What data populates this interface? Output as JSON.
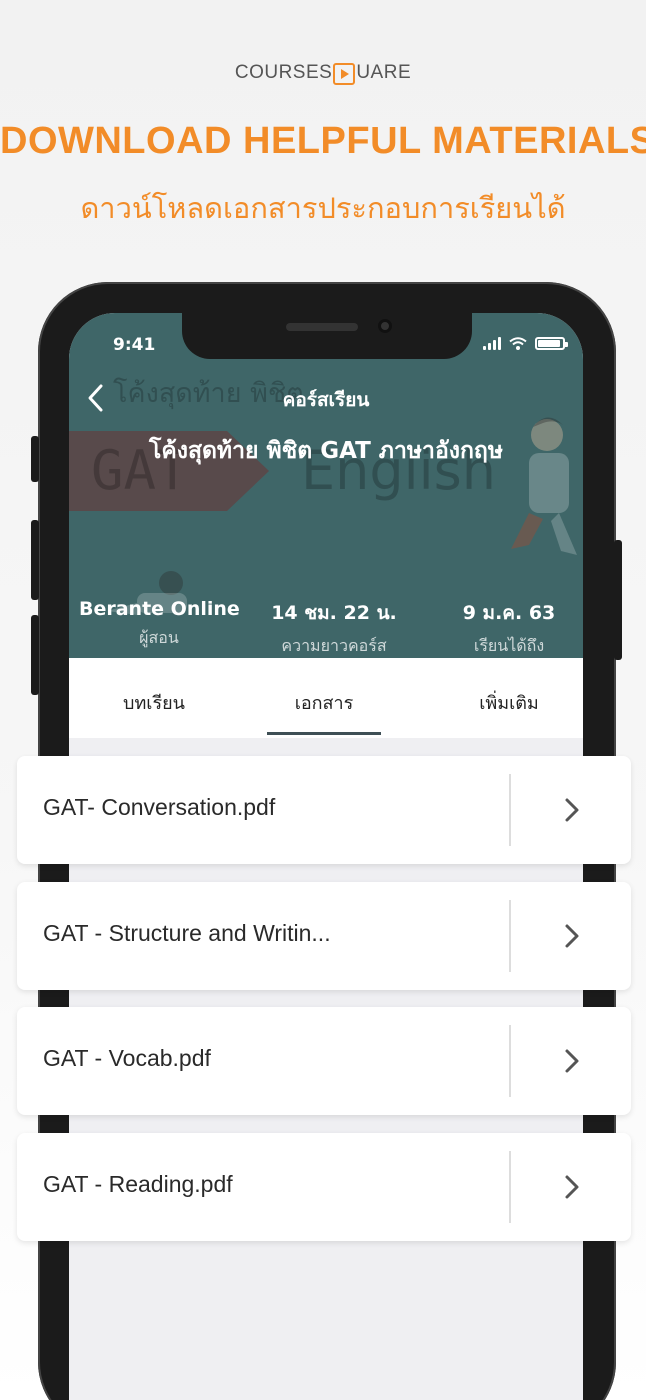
{
  "promo": {
    "logo_left": "COURSES",
    "logo_right": "UARE",
    "headline": "DOWNLOAD HELPFUL MATERIALS",
    "subheadline": "ดาวน์โหลดเอกสารประกอบการเรียนได้"
  },
  "status_bar": {
    "time": "9:41"
  },
  "nav": {
    "title": "คอร์สเรียน"
  },
  "course": {
    "title": "โค้งสุดท้าย พิชิต GAT ภาษาอังกฤษ",
    "hero_bg_title": "โค้งสุดท้าย พิชิต",
    "hero_bg_gat": "GAT",
    "hero_bg_english": "English",
    "stats": [
      {
        "value": "Berante Online",
        "label": "ผู้สอน"
      },
      {
        "value": "14 ชม. 22 น.",
        "label": "ความยาวคอร์ส"
      },
      {
        "value": "9 ม.ค. 63",
        "label": "เรียนได้ถึง"
      }
    ]
  },
  "tabs": [
    {
      "label": "บทเรียน",
      "active": false
    },
    {
      "label": "เอกสาร",
      "active": true
    },
    {
      "label": "เพิ่มเติม",
      "active": false
    }
  ],
  "files": [
    {
      "name": "GAT- Conversation.pdf"
    },
    {
      "name": "GAT - Structure and Writin..."
    },
    {
      "name": "GAT - Vocab.pdf"
    },
    {
      "name": "GAT - Reading.pdf"
    }
  ],
  "colors": {
    "accent": "#f28c28",
    "hero_bg": "#3f6668",
    "tab_indicator": "#3e4f55"
  },
  "icons": [
    "back-chevron-icon",
    "chevron-right-icon",
    "signal-icon",
    "wifi-icon",
    "battery-icon",
    "play-logo-icon"
  ]
}
